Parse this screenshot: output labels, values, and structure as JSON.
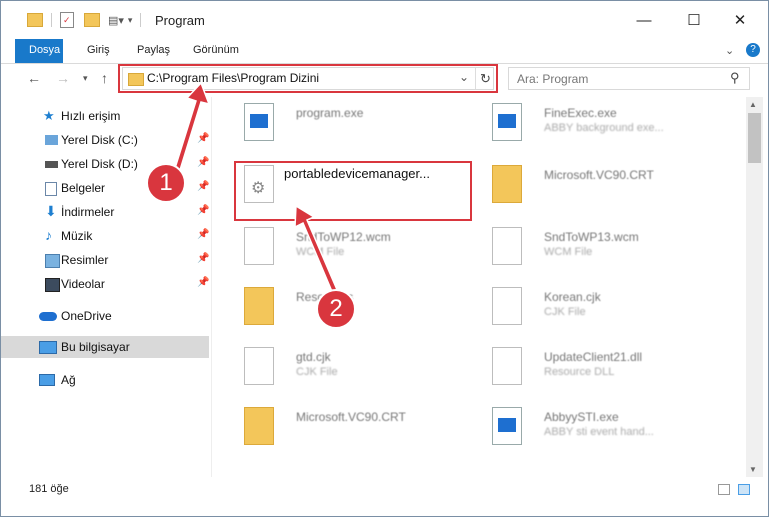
{
  "window": {
    "title": "Program",
    "controls": {
      "minimize": "—",
      "maximize": "☐",
      "close": "✕"
    }
  },
  "ribbon": {
    "tabs": [
      "Dosya",
      "Giriş",
      "Paylaş",
      "Görünüm"
    ],
    "active_tab": "Dosya"
  },
  "address_bar": {
    "path": "C:\\Program Files\\Program Dizini"
  },
  "search": {
    "placeholder": "Ara: Program"
  },
  "sidebar": {
    "items": [
      {
        "label": "Hızlı erişim"
      },
      {
        "label": "Yerel Disk (C:)"
      },
      {
        "label": "Yerel Disk (D:)"
      },
      {
        "label": "Belgeler"
      },
      {
        "label": "İndirmeler"
      },
      {
        "label": "Müzik"
      },
      {
        "label": "Resimler"
      },
      {
        "label": "Videolar"
      },
      {
        "label": "OneDrive"
      },
      {
        "label": "Bu bilgisayar"
      },
      {
        "label": "Ağ"
      }
    ],
    "selected": "Bu bilgisayar"
  },
  "files": [
    {
      "name": "program.exe",
      "sub": ""
    },
    {
      "name": "FineExec.exe",
      "sub": "ABBY background exe..."
    },
    {
      "name": "portabledevicemanager...",
      "sub": ""
    },
    {
      "name": "Microsoft.VC90.CRT",
      "sub": ""
    },
    {
      "name": "SndToWP12.wcm",
      "sub": "WCM File"
    },
    {
      "name": "SndToWP13.wcm",
      "sub": "WCM File"
    },
    {
      "name": "Resources",
      "sub": ""
    },
    {
      "name": "Korean.cjk",
      "sub": "CJK File"
    },
    {
      "name": "gtd.cjk",
      "sub": "CJK File"
    },
    {
      "name": "UpdateClient21.dll",
      "sub": "Resource DLL"
    },
    {
      "name": "Microsoft.VC90.CRT",
      "sub": ""
    },
    {
      "name": "AbbyySTI.exe",
      "sub": "ABBY sti event hand..."
    }
  ],
  "status": {
    "count": "181 öğe"
  },
  "callouts": [
    "1",
    "2"
  ],
  "colors": {
    "accent": "#1979ca",
    "highlight": "#d9363e"
  }
}
